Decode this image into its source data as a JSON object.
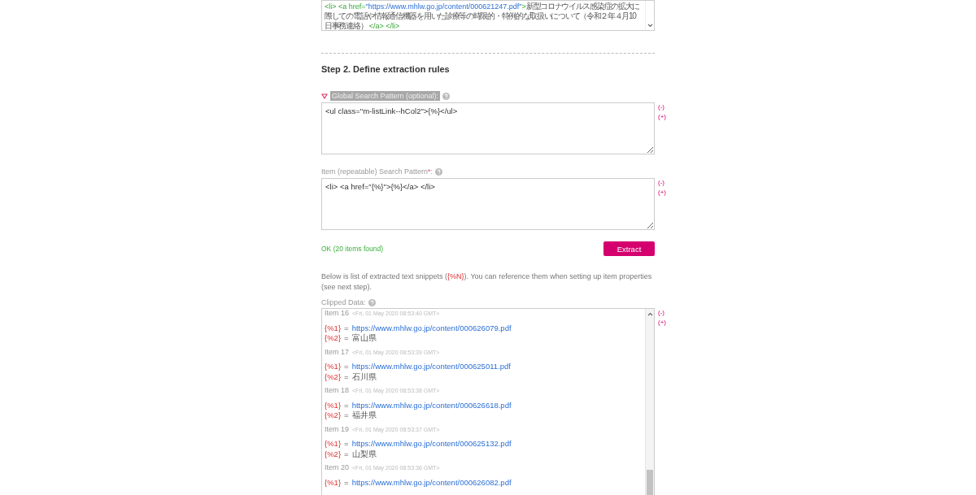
{
  "source_preview": {
    "lines": [
      [
        {
          "kind": "tag",
          "text": "<li> <a href="
        },
        {
          "kind": "value",
          "text": "\"https://www.mhlw.go.jp/content/000621247.pdf\""
        },
        {
          "kind": "tag",
          "text": ">"
        },
        {
          "kind": "text",
          "text": "新型コロナウイルス感染症の拡大に"
        }
      ],
      [
        {
          "kind": "text",
          "text": "際しての電話や情報通信機器を用いた診療等の時限的・特例的な取扱いについて（令和２年４月10"
        }
      ],
      [
        {
          "kind": "text",
          "text": "日事務連絡）"
        },
        {
          "kind": "tag",
          "text": " </a> </li>"
        }
      ]
    ]
  },
  "step_title": "Step 2. Define extraction rules",
  "global_pattern": {
    "expanded": true,
    "label": "Global Search Pattern (optional):",
    "value": "<ul class=\"m-listLink--hCol2\">{%}</ul>",
    "controls": [
      "(-)",
      "(+)"
    ]
  },
  "item_pattern": {
    "label": "Item (repeatable) Search Pattern",
    "required_mark": "*",
    "suffix": ":",
    "value": "<li> <a href=\"{%}\">{%}</a> </li>",
    "controls": [
      "(-)",
      "(+)"
    ]
  },
  "status": "OK (20 items found)",
  "extract_button": "Extract",
  "description": [
    {
      "kind": "text",
      "text": "Below is list of extracted text snippets ("
    },
    {
      "kind": "token",
      "text": "{%N}"
    },
    {
      "kind": "text",
      "text": "). You can reference them when setting up item properties (see next step)."
    }
  ],
  "clipped_data": {
    "label": "Clipped Data:",
    "controls": [
      "(-)",
      "(+)"
    ],
    "items": [
      {
        "title": "Item 16",
        "timestamp": "<Fri, 01 May 2020 08:53:40 GMT>",
        "values": [
          {
            "key": "{%1}",
            "sep": "=",
            "kind": "link",
            "value": "https://www.mhlw.go.jp/content/000626079.pdf"
          },
          {
            "key": "{%2}",
            "sep": "=",
            "kind": "text",
            "value": "富山県"
          }
        ]
      },
      {
        "title": "Item 17",
        "timestamp": "<Fri, 01 May 2020 08:53:39 GMT>",
        "values": [
          {
            "key": "{%1}",
            "sep": "=",
            "kind": "link",
            "value": "https://www.mhlw.go.jp/content/000625011.pdf"
          },
          {
            "key": "{%2}",
            "sep": "=",
            "kind": "text",
            "value": "石川県"
          }
        ]
      },
      {
        "title": "Item 18",
        "timestamp": "<Fri, 01 May 2020 08:53:38 GMT>",
        "values": [
          {
            "key": "{%1}",
            "sep": "=",
            "kind": "link",
            "value": "https://www.mhlw.go.jp/content/000626618.pdf"
          },
          {
            "key": "{%2}",
            "sep": "=",
            "kind": "text",
            "value": "福井県"
          }
        ]
      },
      {
        "title": "Item 19",
        "timestamp": "<Fri, 01 May 2020 08:53:37 GMT>",
        "values": [
          {
            "key": "{%1}",
            "sep": "=",
            "kind": "link",
            "value": "https://www.mhlw.go.jp/content/000625132.pdf"
          },
          {
            "key": "{%2}",
            "sep": "=",
            "kind": "text",
            "value": "山梨県"
          }
        ]
      },
      {
        "title": "Item 20",
        "timestamp": "<Fri, 01 May 2020 08:53:36 GMT>",
        "values": [
          {
            "key": "{%1}",
            "sep": "=",
            "kind": "link",
            "value": "https://www.mhlw.go.jp/content/000626082.pdf"
          }
        ]
      }
    ]
  }
}
